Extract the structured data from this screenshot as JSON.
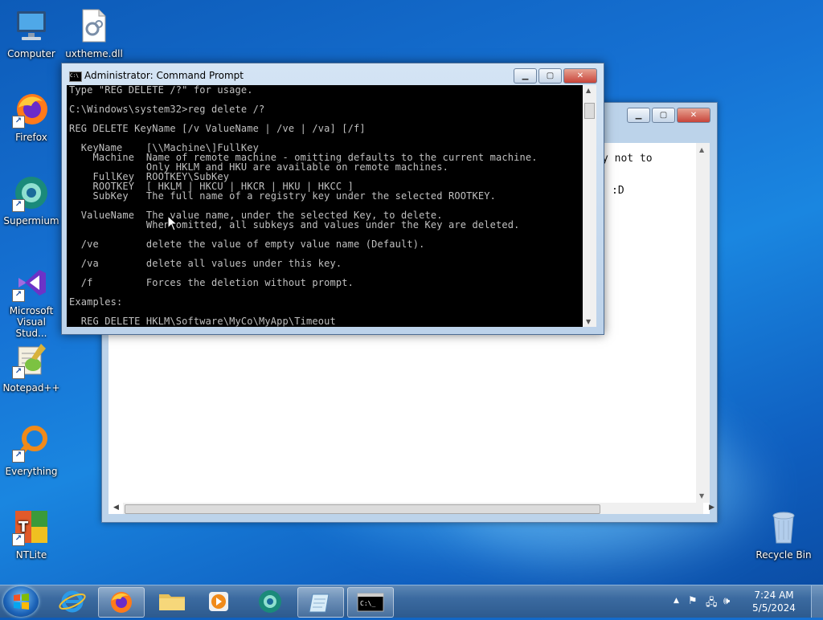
{
  "desktop_icons": [
    {
      "label": "Computer",
      "icon": "computer-icon"
    },
    {
      "label": "uxtheme.dll",
      "icon": "dll-file-icon"
    },
    {
      "label": "Firefox",
      "icon": "firefox-icon"
    },
    {
      "label": "Supermium",
      "icon": "supermium-icon"
    },
    {
      "label": "Microsoft Visual Stud...",
      "icon": "visual-studio-icon"
    },
    {
      "label": "Notepad++",
      "icon": "notepadpp-icon"
    },
    {
      "label": "Everything",
      "icon": "everything-icon"
    },
    {
      "label": "NTLite",
      "icon": "ntlite-icon"
    },
    {
      "label": "Recycle Bin",
      "icon": "recycle-bin-icon"
    }
  ],
  "bg_window": {
    "text_line1": "y not to",
    "text_line2": ":D"
  },
  "cmd_window": {
    "title": "Administrator: Command Prompt",
    "console_lines": [
      "Type \"REG DELETE /?\" for usage.",
      "",
      "C:\\Windows\\system32>reg delete /?",
      "",
      "REG DELETE KeyName [/v ValueName | /ve | /va] [/f]",
      "",
      "  KeyName    [\\\\Machine\\]FullKey",
      "    Machine  Name of remote machine - omitting defaults to the current machine.",
      "             Only HKLM and HKU are available on remote machines.",
      "    FullKey  ROOTKEY\\SubKey",
      "    ROOTKEY  [ HKLM | HKCU | HKCR | HKU | HKCC ]",
      "    SubKey   The full name of a registry key under the selected ROOTKEY.",
      "",
      "  ValueName  The value name, under the selected Key, to delete.",
      "             When omitted, all subkeys and values under the Key are deleted.",
      "",
      "  /ve        delete the value of empty value name (Default).",
      "",
      "  /va        delete all values under this key.",
      "",
      "  /f         Forces the deletion without prompt.",
      "",
      "Examples:",
      "",
      "  REG DELETE HKLM\\Software\\MyCo\\MyApp\\Timeout"
    ]
  },
  "taskbar": {
    "items": [
      {
        "name": "internet-explorer",
        "icon": "ie-icon",
        "active": false
      },
      {
        "name": "firefox",
        "icon": "firefox-icon",
        "active": true
      },
      {
        "name": "file-explorer",
        "icon": "folder-icon",
        "active": false
      },
      {
        "name": "media-player",
        "icon": "media-player-icon",
        "active": false
      },
      {
        "name": "supermium",
        "icon": "supermium-icon",
        "active": false
      },
      {
        "name": "notepad",
        "icon": "notepad-icon",
        "active": true
      },
      {
        "name": "command-prompt",
        "icon": "cmd-icon",
        "active": true
      }
    ],
    "clock_time": "7:24 AM",
    "clock_date": "5/5/2024"
  }
}
